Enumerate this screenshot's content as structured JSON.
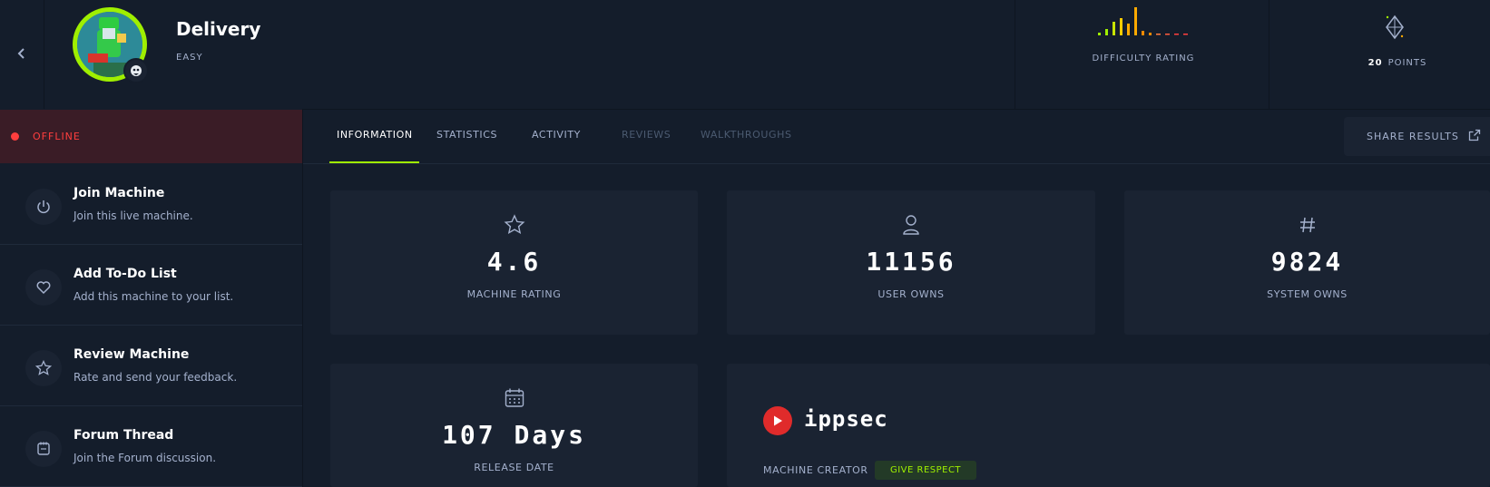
{
  "machine": {
    "name": "Delivery",
    "difficulty": "EASY",
    "status": "OFFLINE",
    "status_color": "#ff3e3e"
  },
  "header": {
    "difficulty_rating_label": "DIFFICULTY RATING",
    "points_value": "20",
    "points_label": "POINTS",
    "back_icon": "chevron-left-icon",
    "os_icon": "linux-icon",
    "points_icon": "diamond-icon"
  },
  "sidebar": {
    "items": [
      {
        "title": "Join Machine",
        "desc": "Join this live machine.",
        "icon": "power-icon"
      },
      {
        "title": "Add To-Do List",
        "desc": "Add this machine to your list.",
        "icon": "heart-icon"
      },
      {
        "title": "Review Machine",
        "desc": "Rate and send your feedback.",
        "icon": "star-icon"
      },
      {
        "title": "Forum Thread",
        "desc": "Join the Forum discussion.",
        "icon": "forum-icon"
      }
    ]
  },
  "tabs": [
    {
      "label": "INFORMATION",
      "state": "active"
    },
    {
      "label": "STATISTICS",
      "state": "normal"
    },
    {
      "label": "ACTIVITY",
      "state": "normal"
    },
    {
      "label": "REVIEWS",
      "state": "disabled"
    },
    {
      "label": "WALKTHROUGHS",
      "state": "disabled"
    }
  ],
  "share": {
    "label": "SHARE RESULTS",
    "icon": "external-link-icon"
  },
  "stats": [
    {
      "value": "4.6",
      "label": "MACHINE RATING",
      "icon": "star-icon"
    },
    {
      "value": "11156",
      "label": "USER OWNS",
      "icon": "user-icon"
    },
    {
      "value": "9824",
      "label": "SYSTEM OWNS",
      "icon": "hash-icon"
    }
  ],
  "release": {
    "value": "107 Days",
    "label": "RELEASE DATE",
    "icon": "calendar-icon"
  },
  "creator": {
    "name": "ippsec",
    "label": "MACHINE CREATOR",
    "respect_button": "GIVE RESPECT",
    "icon": "youtube-play-icon"
  },
  "colors": {
    "accent": "#9fef00",
    "background": "#141d2b",
    "card": "#1a2332",
    "offline_bg": "#3a1c26"
  }
}
